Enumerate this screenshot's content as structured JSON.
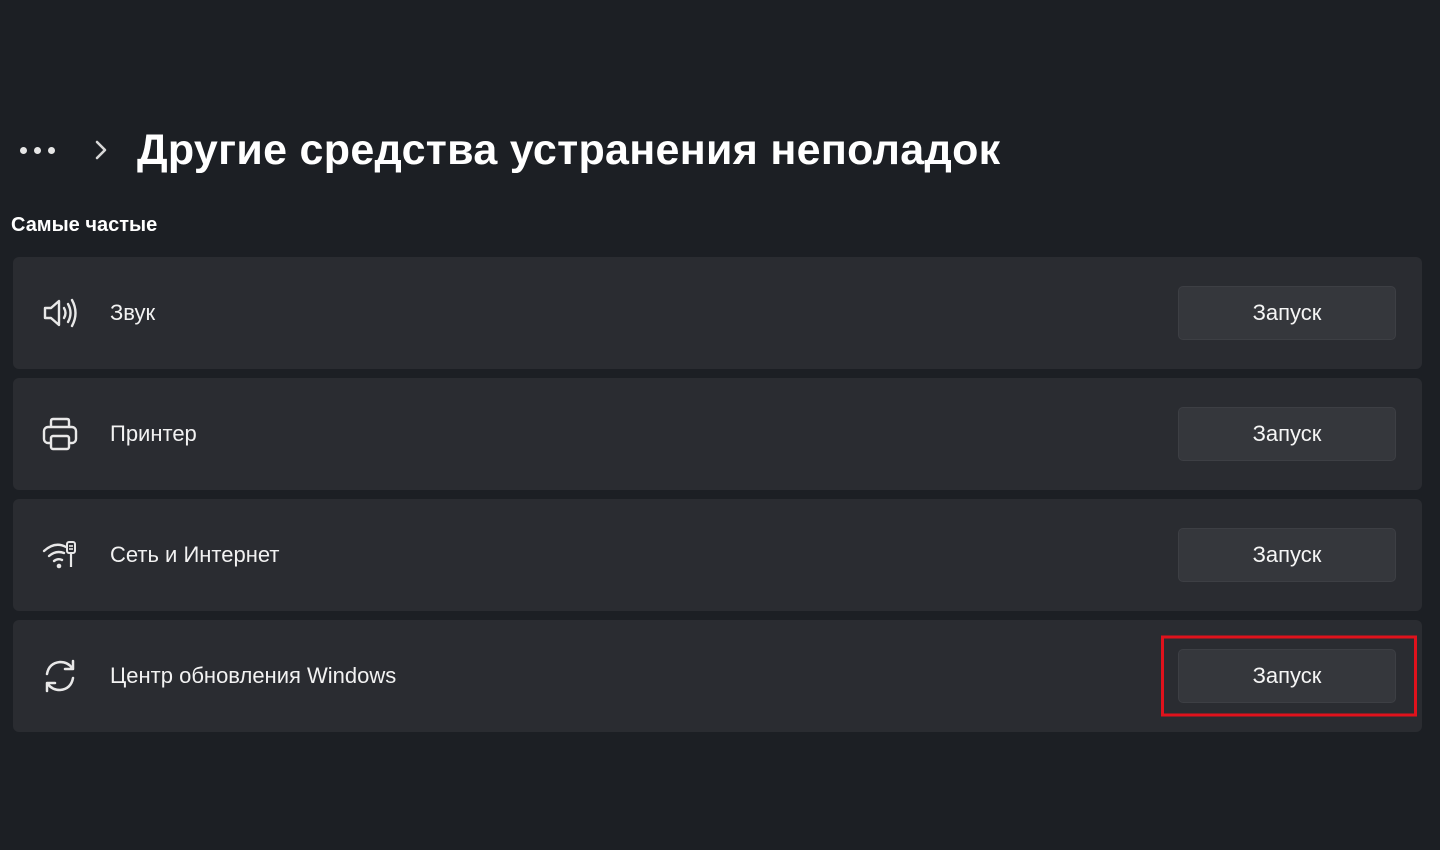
{
  "header": {
    "more_label": "...",
    "title": "Другие средства устранения неполадок"
  },
  "section": {
    "title": "Самые частые"
  },
  "troubleshooters": [
    {
      "icon": "speaker-icon",
      "label": "Звук",
      "button_label": "Запуск",
      "highlighted": false
    },
    {
      "icon": "printer-icon",
      "label": "Принтер",
      "button_label": "Запуск",
      "highlighted": false
    },
    {
      "icon": "network-icon",
      "label": "Сеть и Интернет",
      "button_label": "Запуск",
      "highlighted": false
    },
    {
      "icon": "sync-icon",
      "label": "Центр обновления Windows",
      "button_label": "Запуск",
      "highlighted": true
    }
  ],
  "colors": {
    "background": "#1c1f24",
    "card": "#2a2c31",
    "button": "#35373c",
    "highlight": "#e0121c",
    "text": "#ffffff"
  }
}
